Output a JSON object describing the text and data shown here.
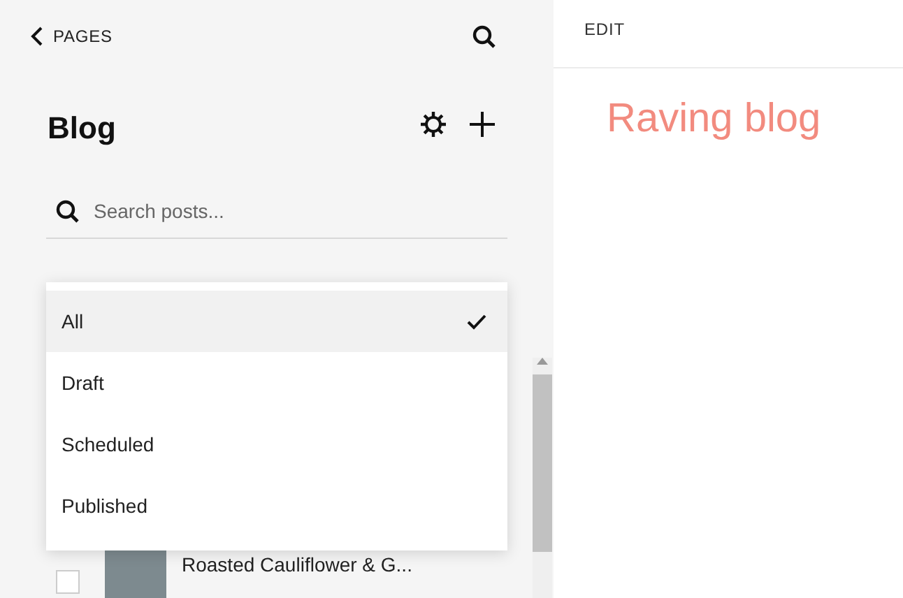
{
  "sidebar": {
    "back_label": "PAGES",
    "title": "Blog",
    "search": {
      "placeholder": "Search posts..."
    },
    "filter_menu": [
      {
        "label": "All",
        "selected": true
      },
      {
        "label": "Draft",
        "selected": false
      },
      {
        "label": "Scheduled",
        "selected": false
      },
      {
        "label": "Published",
        "selected": false
      }
    ],
    "posts": [
      {
        "title": "Roasted Cauliflower & G...",
        "checked": false
      }
    ]
  },
  "editor": {
    "edit_label": "EDIT",
    "site_title": "Raving blog"
  }
}
